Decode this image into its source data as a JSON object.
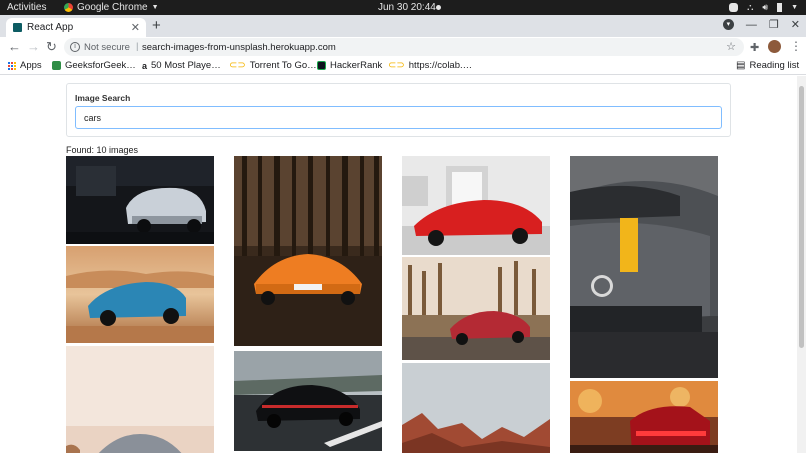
{
  "os_bar": {
    "activities": "Activities",
    "app_name": "Google Chrome",
    "clock": "Jun 30  20:44"
  },
  "browser": {
    "tab_title": "React App",
    "address": {
      "security_label": "Not secure",
      "url": "search-images-from-unsplash.herokuapp.com"
    },
    "bookmarks": [
      {
        "label": "Apps",
        "icon": "apps-grid-icon"
      },
      {
        "label": "GeeksforGeek…",
        "icon": "gfg-icon",
        "color": "#2f8d46"
      },
      {
        "label": "50 Most Playe…",
        "icon": "amazon-icon",
        "color": "#222222"
      },
      {
        "label": "Torrent To Go…",
        "icon": "link-icon",
        "color": "#f4b400"
      },
      {
        "label": "HackerRank",
        "icon": "hackerrank-icon",
        "color": "#1ba94c"
      },
      {
        "label": "https://colab.…",
        "icon": "link-icon",
        "color": "#f4b400"
      }
    ],
    "reading_list": "Reading list"
  },
  "search": {
    "label": "Image Search",
    "value": "cars"
  },
  "results": {
    "found_text": "Found: 10 images"
  },
  "colors": {
    "input_focus_border": "#80bdff",
    "tab_favicon": "#0d5c63"
  }
}
